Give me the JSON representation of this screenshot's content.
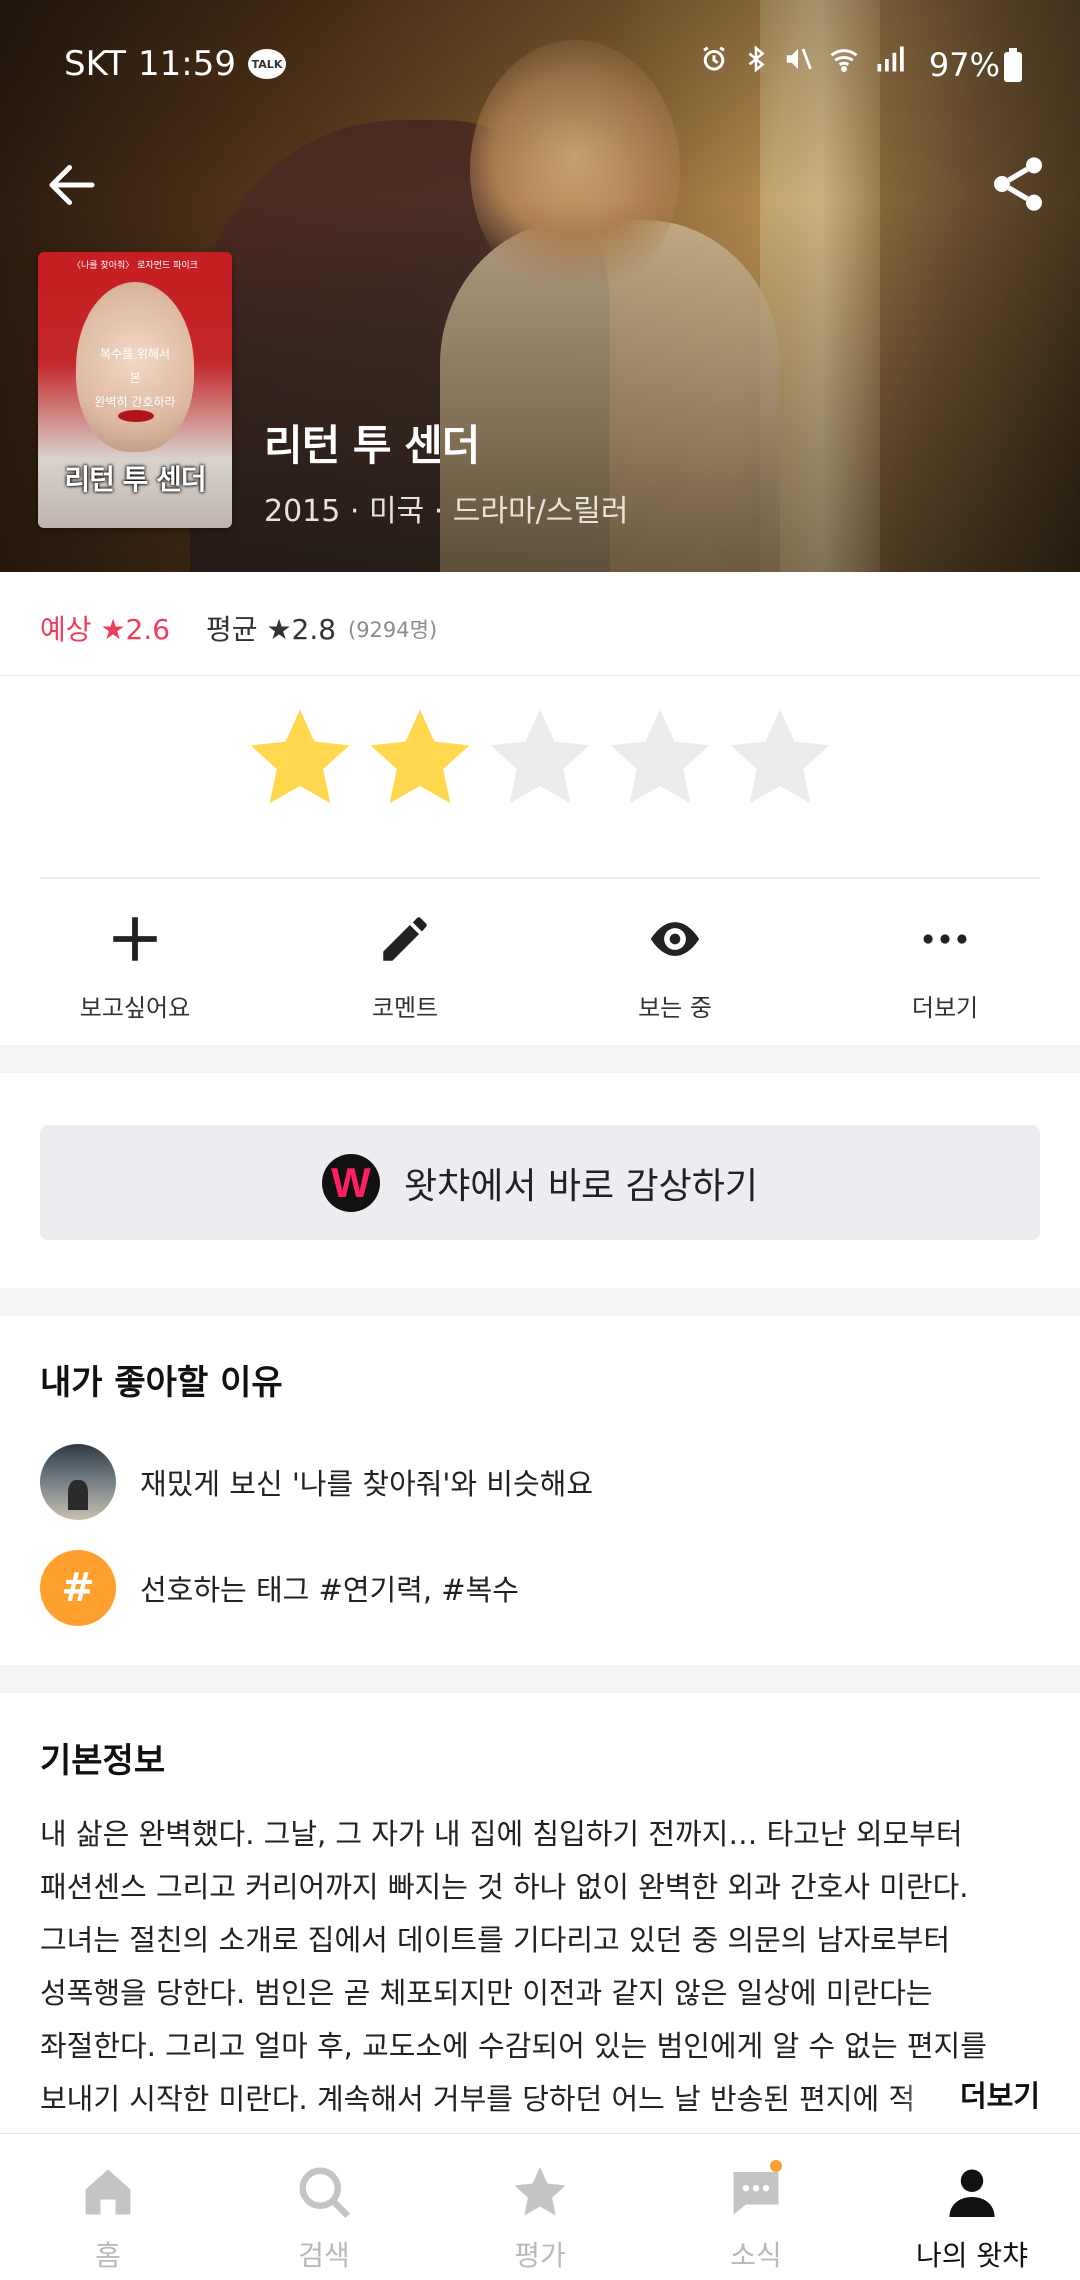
{
  "status_bar": {
    "carrier": "SKT",
    "time": "11:59",
    "talk_badge": "TALK",
    "battery": "97%"
  },
  "header": {
    "back_icon": "arrow-left-icon",
    "share_icon": "share-icon"
  },
  "poster": {
    "title": "리턴 투 센더",
    "top_text": "〈나를 찾아줘〉 로자먼드 파이크",
    "middle_text": [
      "복수를 위해서",
      "본 ",
      "완벽히 간호하라"
    ]
  },
  "movie": {
    "title": "리턴 투 센더",
    "meta": "2015 · 미국 · 드라마/스릴러"
  },
  "rating_summary": {
    "expected_label": "예상",
    "expected_value": "2.6",
    "average_label": "평균",
    "average_value": "2.8",
    "count": "(9294명)"
  },
  "user_rating": {
    "filled": 2,
    "total": 5,
    "filled_color": "#ffd84f",
    "empty_color": "#ececec"
  },
  "actions": [
    {
      "label": "보고싶어요",
      "icon": "plus-icon"
    },
    {
      "label": "코멘트",
      "icon": "pencil-icon"
    },
    {
      "label": "보는 중",
      "icon": "eye-icon"
    },
    {
      "label": "더보기",
      "icon": "more-dots-icon"
    }
  ],
  "watch_button": {
    "logo_letter": "W",
    "label": "왓챠에서 바로 감상하기"
  },
  "reasons": {
    "title": "내가 좋아할 이유",
    "items": [
      {
        "text": "재밌게 보신 '나를 찾아줘'와 비슷해요"
      },
      {
        "icon_text": "#",
        "text": "선호하는 태그 #연기력, #복수"
      }
    ]
  },
  "basic_info": {
    "title": "기본정보",
    "lines": [
      "내 삶은 완벽했다. 그날, 그 자가 내 집에 침입하기 전까지… 타고난 외모부터",
      "패션센스 그리고 커리어까지 빠지는 것 하나 없이 완벽한 외과 간호사 미란다.",
      "그녀는 절친의 소개로 집에서 데이트를 기다리고 있던 중 의문의 남자로부터",
      "성폭행을 당한다. 범인은 곧 체포되지만 이전과 같지 않은 일상에 미란다는",
      "좌절한다. 그리고 얼마 후, 교도소에 수감되어 있는 범인에게 알 수 없는 편지를",
      "보내기 시작한 미란다. 계속해서 거부를 당하던 어느 날 반송된 편지에 적"
    ],
    "more_label": "더보기"
  },
  "bottom_nav": [
    {
      "label": "홈",
      "icon": "home-icon",
      "active": false
    },
    {
      "label": "검색",
      "icon": "search-icon",
      "active": false
    },
    {
      "label": "평가",
      "icon": "star-icon",
      "active": false
    },
    {
      "label": "소식",
      "icon": "chat-bubble-icon",
      "active": false,
      "badge": true
    },
    {
      "label": "나의 왓챠",
      "icon": "person-icon",
      "active": true
    }
  ]
}
